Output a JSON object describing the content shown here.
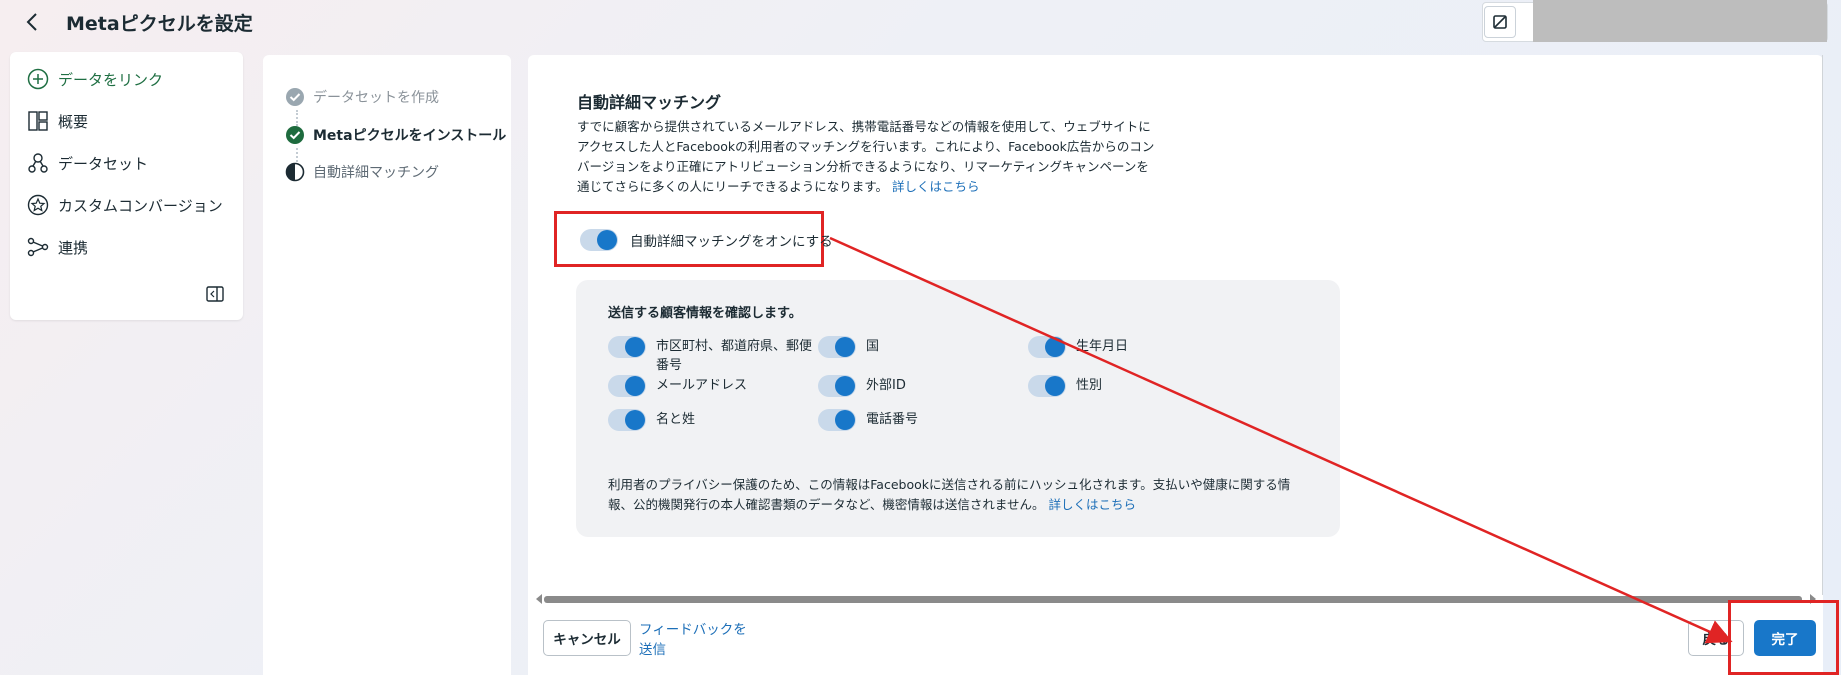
{
  "header": {
    "title": "Metaピクセルを設定"
  },
  "sidebar": {
    "items": [
      {
        "label": "データをリンク",
        "icon": "plus-circle-icon"
      },
      {
        "label": "概要",
        "icon": "layout-icon"
      },
      {
        "label": "データセット",
        "icon": "dataset-icon"
      },
      {
        "label": "カスタムコンバージョン",
        "icon": "star-circle-icon"
      },
      {
        "label": "連携",
        "icon": "integration-icon"
      }
    ]
  },
  "steps": [
    {
      "label": "データセットを作成",
      "state": "done"
    },
    {
      "label": "Metaピクセルをインストール",
      "state": "current"
    },
    {
      "label": "自動詳細マッチング",
      "state": "upcoming"
    }
  ],
  "main": {
    "section_title": "自動詳細マッチング",
    "description": "すでに顧客から提供されているメールアドレス、携帯電話番号などの情報を使用して、ウェブサイトにアクセスした人とFacebookの利用者のマッチングを行います。これにより、Facebook広告からのコンバージョンをより正確にアトリビューション分析できるようになり、リマーケティングキャンペーンを通じてさらに多くの人にリーチできるようになります。",
    "learn_more": "詳しくはこちら",
    "master_toggle_label": "自動詳細マッチングをオンにする",
    "master_toggle_on": true,
    "panel": {
      "heading": "送信する顧客情報を確認します。",
      "fields": [
        {
          "label": "市区町村、都道府県、郵便番号",
          "on": true
        },
        {
          "label": "国",
          "on": true
        },
        {
          "label": "生年月日",
          "on": true
        },
        {
          "label": "メールアドレス",
          "on": true
        },
        {
          "label": "外部ID",
          "on": true
        },
        {
          "label": "性別",
          "on": true
        },
        {
          "label": "名と姓",
          "on": true
        },
        {
          "label": "電話番号",
          "on": true
        }
      ],
      "note": "利用者のプライバシー保護のため、この情報はFacebookに送信される前にハッシュ化されます。支払いや健康に関する情報、公的機関発行の本人確認書類のデータなど、機密情報は送信されません。",
      "note_link": "詳しくはこちら"
    }
  },
  "footer": {
    "cancel_label": "キャンセル",
    "feedback_label": "フィードバックを送信",
    "back_label": "戻る",
    "done_label": "完了"
  },
  "colors": {
    "accent": "#1877c9",
    "link": "#1d6fb8",
    "annotation": "#e02424",
    "primary_nav": "#1f6f43"
  }
}
